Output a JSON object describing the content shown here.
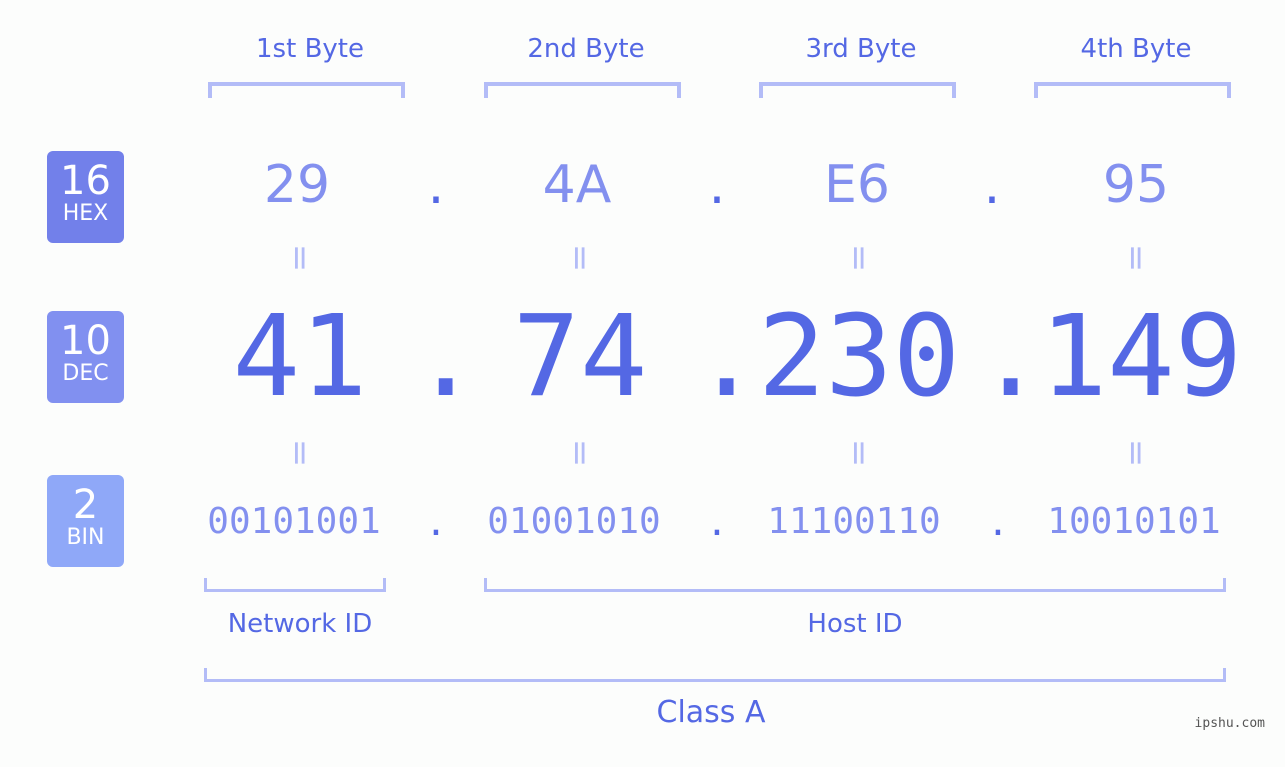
{
  "byte_headers": [
    "1st Byte",
    "2nd Byte",
    "3rd Byte",
    "4th Byte"
  ],
  "bases": [
    {
      "number": "16",
      "label": "HEX",
      "color": "#7280ea"
    },
    {
      "number": "10",
      "label": "DEC",
      "color": "#8190f0"
    },
    {
      "number": "2",
      "label": "BIN",
      "color": "#8fa8f8"
    }
  ],
  "hex": [
    "29",
    "4A",
    "E6",
    "95"
  ],
  "dec": [
    "41",
    "74",
    "230",
    "149"
  ],
  "bin": [
    "00101001",
    "01001010",
    "11100110",
    "10010101"
  ],
  "separator": ".",
  "equals": "=",
  "segments": {
    "network": "Network ID",
    "host": "Host ID"
  },
  "class_label": "Class A",
  "watermark": "ipshu.com",
  "colors": {
    "accent": "#5468e4",
    "light": "#8390ef",
    "bracket": "#b3bcf7"
  }
}
